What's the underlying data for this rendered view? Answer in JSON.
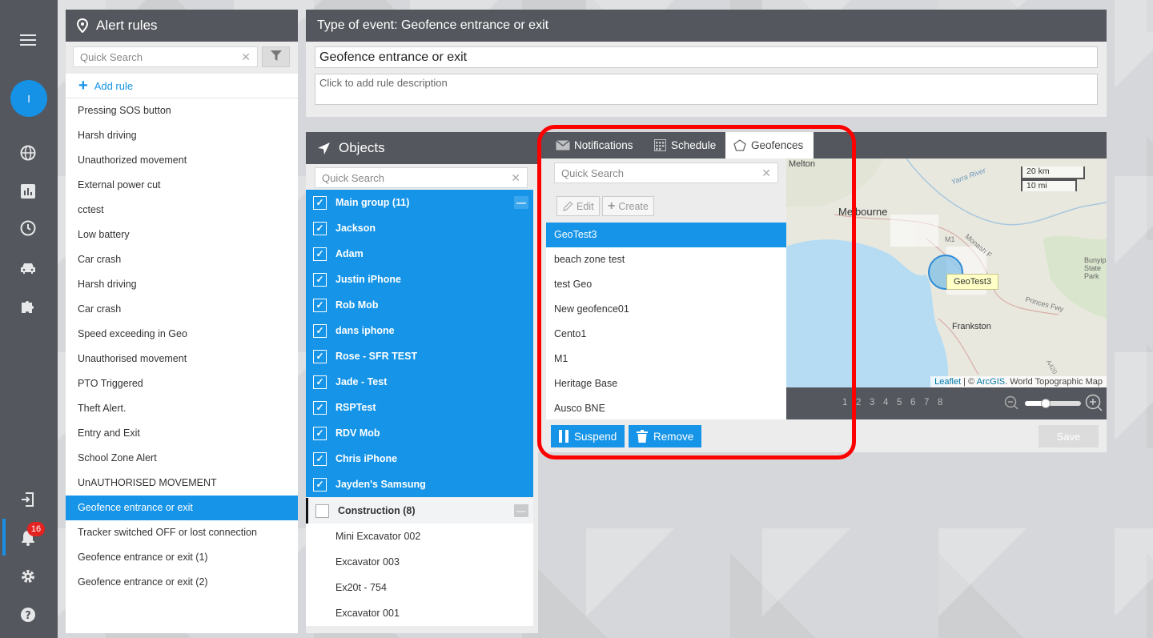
{
  "nav": {
    "avatar_initial": "I",
    "badge_count": "16",
    "icons": [
      "menu-icon",
      "globe-icon",
      "chart-icon",
      "clock-icon",
      "car-icon",
      "puzzle-icon",
      "logout-icon",
      "bell-icon",
      "gear-icon",
      "help-icon"
    ]
  },
  "rules": {
    "title": "Alert rules",
    "search_placeholder": "Quick Search",
    "add_rule": "Add rule",
    "items": [
      "Pressing SOS button",
      "Harsh driving",
      "Unauthorized movement",
      "External power cut",
      "cctest",
      "Low battery",
      "Car crash",
      "Harsh driving",
      "Car crash",
      "Speed exceeding in Geo",
      "Unauthorised movement",
      "PTO Triggered",
      "Theft Alert.",
      "Entry and Exit",
      "School Zone Alert",
      "UnAUTHORISED MOVEMENT",
      "Geofence entrance or exit",
      "Tracker switched OFF or lost connection",
      "Geofence entrance or exit (1)",
      "Geofence entrance or exit (2)"
    ],
    "active_index": 16
  },
  "event": {
    "title": "Type of event: Geofence entrance or exit",
    "name_value": "Geofence entrance or exit",
    "description_placeholder": "Click to add rule description"
  },
  "objects": {
    "title": "Objects",
    "search_placeholder": "Quick Search",
    "groups": [
      {
        "name": "Main group (11)",
        "checked": true,
        "items": [
          "Jackson",
          "Adam",
          "Justin iPhone",
          "Rob Mob",
          "dans iphone",
          "Rose - SFR TEST",
          "Jade - Test",
          "RSPTest",
          "RDV Mob",
          "Chris iPhone",
          "Jayden's Samsung"
        ]
      },
      {
        "name": "Construction (8)",
        "checked": false,
        "items": [
          "Mini Excavator 002",
          "Excavator 003",
          "Ex20t - 754",
          "Excavator 001"
        ]
      }
    ]
  },
  "settings": {
    "tabs": [
      "Notifications",
      "Schedule",
      "Geofences"
    ],
    "active_tab": "Geofences",
    "search_placeholder": "Quick Search",
    "edit_label": "Edit",
    "create_label": "Create",
    "geofences": [
      "GeoTest3",
      "beach zone test",
      "test Geo",
      "New geofence01",
      "Cento1",
      "M1",
      "Heritage Base",
      "Ausco BNE"
    ],
    "active_geofence": "GeoTest3",
    "suspend_label": "Suspend",
    "remove_label": "Remove",
    "save_label": "Save"
  },
  "map": {
    "place_labels": [
      "Melton",
      "Melbourne",
      "Frankston",
      "Bunyip State Park",
      "Yarra River",
      "Monash F",
      "Princes Fwy",
      "M1",
      "A420"
    ],
    "geofence_tooltip": "GeoTest3",
    "scale_km": "20 km",
    "scale_mi": "10 mi",
    "attribution_leaflet": "Leaflet",
    "attribution_sep": " | © ",
    "attribution_arcgis": "ArcGIS",
    "attribution_rest": ". World Topographic Map",
    "pages": [
      "1",
      "2",
      "3",
      "4",
      "5",
      "6",
      "7",
      "8"
    ]
  },
  "colors": {
    "header": "#54575d",
    "accent": "#1594e8",
    "highlight": "#fd0000"
  }
}
